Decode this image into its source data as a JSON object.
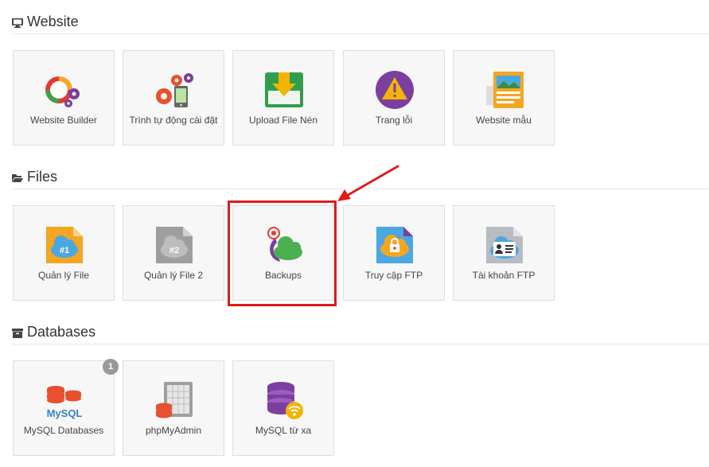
{
  "sections": {
    "website": {
      "title": "Website",
      "items": [
        {
          "label": "Website Builder",
          "icon": "website-builder-icon"
        },
        {
          "label": "Trình tự động cài đặt",
          "icon": "auto-installer-icon"
        },
        {
          "label": "Upload File Nén",
          "icon": "upload-archive-icon"
        },
        {
          "label": "Trang lỗi",
          "icon": "error-page-icon"
        },
        {
          "label": "Website mẫu",
          "icon": "website-template-icon"
        }
      ]
    },
    "files": {
      "title": "Files",
      "items": [
        {
          "label": "Quản lý File",
          "icon": "file-manager-1-icon",
          "icon_text": "#1"
        },
        {
          "label": "Quản lý File 2",
          "icon": "file-manager-2-icon",
          "icon_text": "#2"
        },
        {
          "label": "Backups",
          "icon": "backups-icon"
        },
        {
          "label": "Truy cập FTP",
          "icon": "ftp-access-icon"
        },
        {
          "label": "Tài khoản FTP",
          "icon": "ftp-accounts-icon"
        }
      ]
    },
    "databases": {
      "title": "Databases",
      "items": [
        {
          "label": "MySQL Databases",
          "icon": "mysql-icon",
          "icon_text": "MySQL",
          "badge": "1"
        },
        {
          "label": "phpMyAdmin",
          "icon": "phpmyadmin-icon"
        },
        {
          "label": "MySQL từ xa",
          "icon": "remote-mysql-icon"
        }
      ]
    }
  },
  "annotation": {
    "highlight_color": "#e01b1b",
    "highlighted_item": "Backups"
  }
}
